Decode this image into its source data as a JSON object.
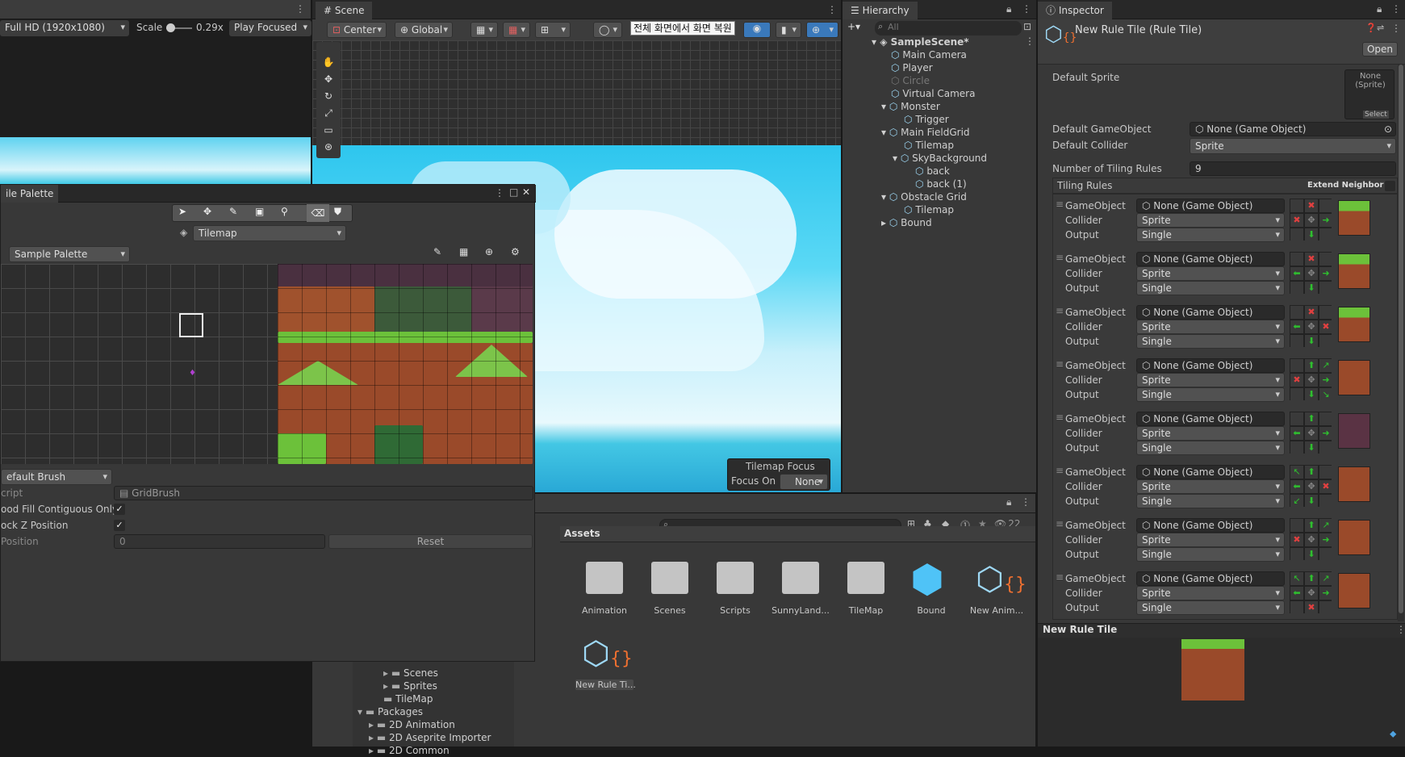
{
  "game_view": {
    "resolution": "Full HD (1920x1080)",
    "scale_label": "Scale",
    "scale_value": "0.29x",
    "play_mode": "Play Focused"
  },
  "scene": {
    "tab": "Scene",
    "pivot": "Center",
    "space": "Global",
    "ime_text": "전체 화면에서 화면 복원",
    "tilemap_focus_title": "Tilemap Focus",
    "focus_on_label": "Focus On",
    "focus_on_value": "None"
  },
  "palette": {
    "tab": "ile Palette",
    "active_tilemap": "Tilemap",
    "palette_name": "Sample Palette",
    "brush": "efault Brush",
    "script_label": "cript",
    "script_value": "GridBrush",
    "flood_fill_label": "ood Fill Contiguous Only",
    "lock_z_label": "ock Z Position",
    "z_position_label": " Position",
    "z_position_value": "0",
    "reset_label": "Reset"
  },
  "hierarchy": {
    "tab": "Hierarchy",
    "search_placeholder": "All",
    "items": [
      {
        "label": "SampleScene*",
        "depth": 0,
        "bold": true
      },
      {
        "label": "Main Camera",
        "depth": 1
      },
      {
        "label": "Player",
        "depth": 1
      },
      {
        "label": "Circle",
        "depth": 1,
        "disabled": true
      },
      {
        "label": "Virtual Camera",
        "depth": 1
      },
      {
        "label": "Monster",
        "depth": 1
      },
      {
        "label": "Trigger",
        "depth": 2
      },
      {
        "label": "Main FieldGrid",
        "depth": 1
      },
      {
        "label": "Tilemap",
        "depth": 2
      },
      {
        "label": "SkyBackground",
        "depth": 2
      },
      {
        "label": "back",
        "depth": 3
      },
      {
        "label": "back (1)",
        "depth": 3
      },
      {
        "label": "Obstacle Grid",
        "depth": 1
      },
      {
        "label": "Tilemap",
        "depth": 2
      },
      {
        "label": "Bound",
        "depth": 1
      }
    ]
  },
  "project": {
    "count": "22",
    "assets_title": "Assets",
    "assets": [
      {
        "label": "Animation"
      },
      {
        "label": "Scenes"
      },
      {
        "label": "Scripts"
      },
      {
        "label": "SunnyLand..."
      },
      {
        "label": "TileMap"
      },
      {
        "label": "Bound"
      },
      {
        "label": "New Anim..."
      },
      {
        "label": "New Rule Ti..."
      }
    ],
    "tree": [
      {
        "label": "Scenes"
      },
      {
        "label": "Sprites"
      },
      {
        "label": "TileMap"
      },
      {
        "label": "Packages"
      },
      {
        "label": "2D Animation"
      },
      {
        "label": "2D Aseprite Importer"
      },
      {
        "label": "2D Common"
      }
    ]
  },
  "inspector": {
    "tab": "Inspector",
    "title": "New Rule Tile (Rule Tile)",
    "open_label": "Open",
    "default_sprite_label": "Default Sprite",
    "default_sprite_value": "None (Sprite)",
    "select_label": "Select",
    "default_gameobject_label": "Default GameObject",
    "default_gameobject_value": "None (Game Object)",
    "default_collider_label": "Default Collider",
    "default_collider_value": "Sprite",
    "tiling_rules_count_label": "Number of Tiling Rules",
    "tiling_rules_count": "9",
    "tiling_rules_label": "Tiling Rules",
    "extend_neighbor_label": "Extend Neighbor",
    "rule_gameobject_label": "GameObject",
    "rule_collider_label": "Collider",
    "rule_output_label": "Output",
    "rules": [
      {
        "gameobject": "None (Game Object)",
        "collider": "Sprite",
        "output": "Single"
      },
      {
        "gameobject": "None (Game Object)",
        "collider": "Sprite",
        "output": "Single"
      },
      {
        "gameobject": "None (Game Object)",
        "collider": "Sprite",
        "output": "Single"
      },
      {
        "gameobject": "None (Game Object)",
        "collider": "Sprite",
        "output": "Single"
      },
      {
        "gameobject": "None (Game Object)",
        "collider": "Sprite",
        "output": "Single"
      },
      {
        "gameobject": "None (Game Object)",
        "collider": "Sprite",
        "output": "Single"
      },
      {
        "gameobject": "None (Game Object)",
        "collider": "Sprite",
        "output": "Single"
      },
      {
        "gameobject": "None (Game Object)",
        "collider": "Sprite",
        "output": "Single"
      }
    ],
    "preview_title": "New Rule Tile"
  },
  "colors": {
    "panel": "#383838",
    "field": "#2a2a2a",
    "accent": "#3a79bb",
    "sky": "#2ec6ee",
    "dirt": "#a0522d",
    "grass": "#6cc13a"
  }
}
